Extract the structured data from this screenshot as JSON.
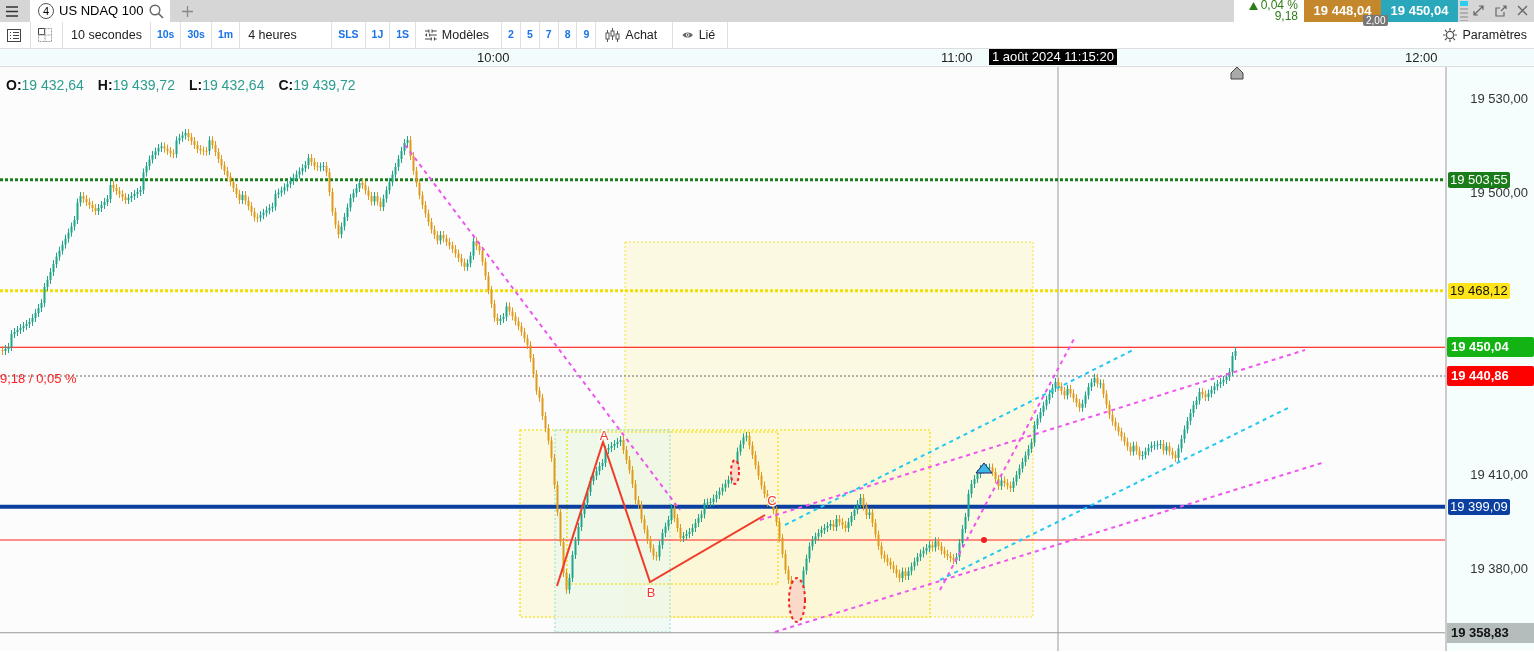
{
  "instrument_tab": {
    "number": "4",
    "label": "US NDAQ 100"
  },
  "quote": {
    "change": "0,04 %",
    "change_points": "9,18",
    "sell": "19 448,04",
    "buy": "19 450,04",
    "spread": "2,00"
  },
  "toolbar": [
    {
      "kind": "list"
    },
    {
      "kind": "layout"
    },
    {
      "kind": "period",
      "label": "10 secondes"
    },
    {
      "kind": "interval",
      "label": "10s"
    },
    {
      "kind": "interval",
      "label": "30s"
    },
    {
      "kind": "interval",
      "label": "1m"
    },
    {
      "kind": "period",
      "label": "4 heures"
    },
    {
      "kind": "interval",
      "label": "SLS"
    },
    {
      "kind": "interval",
      "label": "1J"
    },
    {
      "kind": "interval",
      "label": "1S"
    },
    {
      "kind": "templates",
      "label": "Modèles"
    },
    {
      "kind": "interval",
      "label": "2"
    },
    {
      "kind": "interval",
      "label": "5"
    },
    {
      "kind": "interval",
      "label": "7"
    },
    {
      "kind": "interval",
      "label": "8"
    },
    {
      "kind": "interval",
      "label": "9"
    },
    {
      "kind": "chart-type",
      "label": "Achat"
    },
    {
      "kind": "link",
      "label": "Lié"
    }
  ],
  "settings": "Paramètres",
  "time_axis": {
    "labels": [
      "10:00",
      "11:00",
      "12:00"
    ],
    "crosshair": "1 août 2024 11:15:20"
  },
  "ohlc": [
    {
      "key": "O:",
      "value": "19 432,64"
    },
    {
      "key": "H:",
      "value": "19 439,72"
    },
    {
      "key": "L:",
      "value": "19 432,64"
    },
    {
      "key": "C:",
      "value": "19 439,72"
    }
  ],
  "change_annotation": "9,18 / 0,05 %",
  "pattern_labels": [
    "A",
    "B",
    "C"
  ],
  "price_axis": {
    "ticks": [
      "19 530,00",
      "19 500,00",
      "19 410,00",
      "19 380,00"
    ]
  },
  "price_lines": [
    {
      "value": "19 503,55",
      "kind": "alert",
      "color": "#1a7d1a"
    },
    {
      "value": "19 468,12",
      "kind": "alert",
      "color": "#ffe41a"
    },
    {
      "value": "19 450,04",
      "kind": "quote",
      "color": "#12b312"
    },
    {
      "value": "19 440,86",
      "kind": "quote",
      "color": "#ff0000"
    },
    {
      "value": "19 399,09",
      "kind": "alert",
      "color": "#0b3fa0"
    },
    {
      "value": "19 358,83",
      "kind": "low",
      "color": "#b4bcbc"
    }
  ]
}
